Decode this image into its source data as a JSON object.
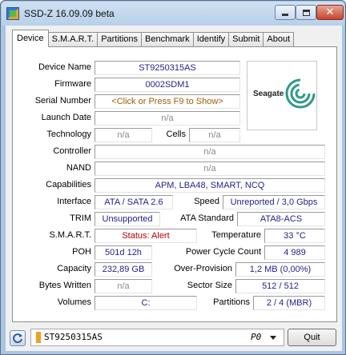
{
  "window": {
    "title": "SSD-Z 16.09.09 beta"
  },
  "tabs": [
    "Device",
    "S.M.A.R.T.",
    "Partitions",
    "Benchmark",
    "Identify",
    "Submit",
    "About"
  ],
  "active_tab": "Device",
  "device": {
    "device_name_label": "Device Name",
    "device_name": "ST9250315AS",
    "firmware_label": "Firmware",
    "firmware": "0002SDM1",
    "serial_label": "Serial Number",
    "serial": "<Click or Press F9 to Show>",
    "launch_date_label": "Launch Date",
    "launch_date": "n/a",
    "technology_label": "Technology",
    "technology": "n/a",
    "cells_label": "Cells",
    "cells": "n/a",
    "controller_label": "Controller",
    "controller": "n/a",
    "nand_label": "NAND",
    "nand": "n/a",
    "capabilities_label": "Capabilities",
    "capabilities": "APM, LBA48, SMART, NCQ",
    "interface_label": "Interface",
    "interface": "ATA / SATA 2.6",
    "speed_label": "Speed",
    "speed": "Unreported / 3,0 Gbps",
    "trim_label": "TRIM",
    "trim": "Unsupported",
    "ata_standard_label": "ATA Standard",
    "ata_standard": "ATA8-ACS",
    "smart_label": "S.M.A.R.T.",
    "smart": "Status: Alert",
    "temperature_label": "Temperature",
    "temperature": "33 °C",
    "poh_label": "POH",
    "poh": "501d 12h",
    "power_cycle_label": "Power Cycle Count",
    "power_cycle": "4 989",
    "capacity_label": "Capacity",
    "capacity": "232,89 GB",
    "over_provision_label": "Over-Provision",
    "over_provision": "1,2 MB (0,00%)",
    "bytes_written_label": "Bytes Written",
    "bytes_written": "n/a",
    "sector_size_label": "Sector Size",
    "sector_size": "512 / 512",
    "volumes_label": "Volumes",
    "volumes": "C:",
    "partitions_label": "Partitions",
    "partitions": "2 / 4 (MBR)"
  },
  "logo": {
    "brand": "Seagate",
    "icon": "seagate-logo-icon"
  },
  "bottom": {
    "drive": "ST9250315AS",
    "port": "P0",
    "quit_label": "Quit",
    "refresh_icon": "refresh-icon",
    "drive_color": "#f0a020"
  },
  "colors": {
    "value_text": "#23238c",
    "alert_text": "#b00000",
    "link_text": "#a35a00",
    "na_text": "#8a8a8a",
    "titlebar": "#b8d0ea"
  }
}
